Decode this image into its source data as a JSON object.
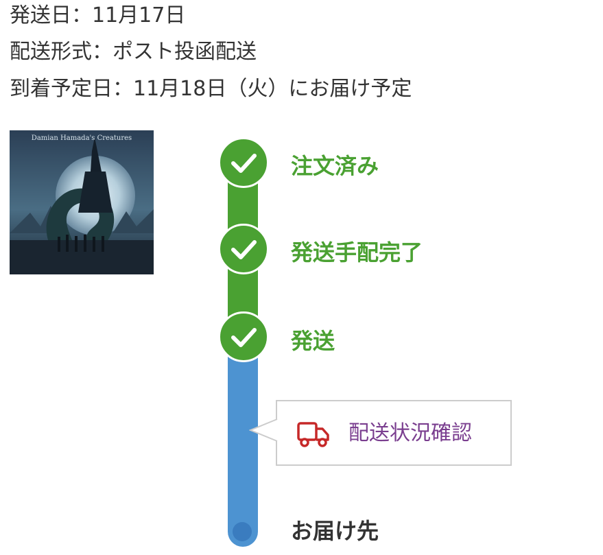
{
  "shipping_info": {
    "ship_date": "発送日：11月17日",
    "shipping_method": "配送形式：ポスト投函配送",
    "arrival_date": "到着予定日：11月18日（火）にお届け予定"
  },
  "product": {
    "cover_text": "Damian Hamada's Creatures"
  },
  "progress": {
    "steps": [
      {
        "label": "注文済み",
        "status": "complete"
      },
      {
        "label": "発送手配完了",
        "status": "complete"
      },
      {
        "label": "発送",
        "status": "complete"
      },
      {
        "label": "お届け先",
        "status": "pending"
      }
    ],
    "tracking_link_label": "配送状況確認"
  },
  "colors": {
    "complete": "#4aa132",
    "in_transit": "#4d93d1",
    "link": "#7a3e8f",
    "truck_icon": "#c62828"
  }
}
